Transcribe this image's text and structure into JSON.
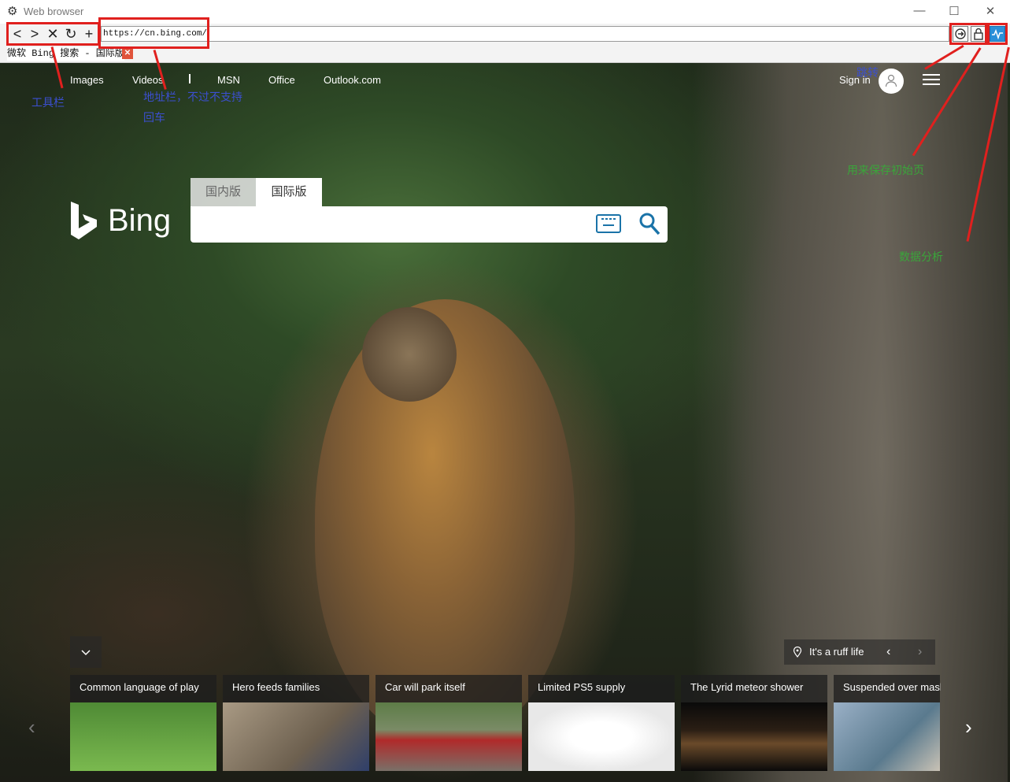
{
  "window": {
    "title": "Web browser",
    "minimize": "—",
    "maximize": "☐",
    "close": "✕"
  },
  "toolbar": {
    "back": "<",
    "forward": ">",
    "stop": "✕",
    "reload": "↻",
    "new_tab": "+"
  },
  "address_bar": {
    "value": "https://cn.bing.com/"
  },
  "tab": {
    "label": "微软 Bing 搜索 - 国际版",
    "close": "✕"
  },
  "bing": {
    "nav": [
      "Images",
      "Videos",
      "MSN",
      "Office",
      "Outlook.com"
    ],
    "sign_in": "Sign in",
    "logo": "Bing",
    "search_tabs": [
      "国内版",
      "国际版"
    ],
    "keyboard_label": "⌨",
    "location_label": "It's a ruff life",
    "cards": [
      {
        "title": "Common language of play",
        "color": "#6aa548"
      },
      {
        "title": "Hero feeds families",
        "color": "#8c7d6a"
      },
      {
        "title": "Car will park itself",
        "color": "#b23b3b"
      },
      {
        "title": "Limited PS5 supply",
        "color": "#f2f2f2"
      },
      {
        "title": "The Lyrid meteor shower",
        "color": "#3a2a1a"
      },
      {
        "title": "Suspended over masl",
        "color": "#9ab0c6"
      }
    ]
  },
  "annotations": {
    "toolbar": "工具栏",
    "address_line1": "地址栏，不过不支持",
    "address_line2": "回车",
    "jump": "跳转",
    "save_home": "用来保存初始页",
    "analytics": "数据分析"
  },
  "colors": {
    "annotation_red": "#e0201e",
    "annotation_blue": "#3b4fd1",
    "annotation_green": "#3aa53a"
  }
}
